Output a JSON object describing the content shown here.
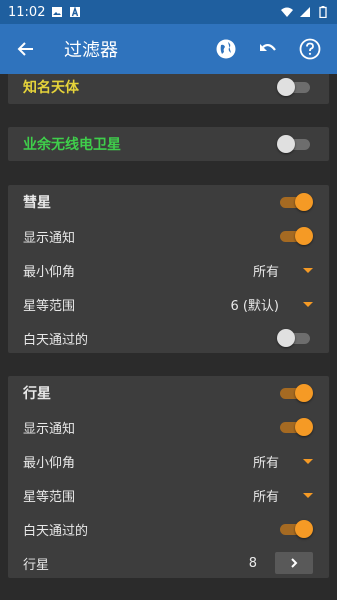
{
  "status_bar": {
    "time": "11:02",
    "left_icons": [
      "image-icon",
      "a-notification-icon"
    ],
    "right_icons": [
      "wifi-icon",
      "signal-icon",
      "battery-icon"
    ]
  },
  "app_bar": {
    "title": "过滤器",
    "back_icon": "back-arrow-icon",
    "actions": [
      "globe-icon",
      "undo-icon",
      "help-icon"
    ]
  },
  "colors": {
    "famous_label": "#e5d33a",
    "ham_label": "#3fce4b",
    "accent": "#f59a25",
    "appbar": "#2f73bd",
    "statusbar": "#1f5f9f"
  },
  "famous": {
    "label": "知名天体",
    "enabled": false
  },
  "ham": {
    "label": "业余无线电卫星",
    "enabled": false
  },
  "comets": {
    "title": "彗星",
    "enabled": true,
    "notify_label": "显示通知",
    "notify": true,
    "min_elev_label": "最小仰角",
    "min_elev_value": "所有",
    "mag_label": "星等范围",
    "mag_value": "6 (默认)",
    "daytime_label": "白天通过的",
    "daytime": false
  },
  "planets": {
    "title": "行星",
    "enabled": true,
    "notify_label": "显示通知",
    "notify": true,
    "min_elev_label": "最小仰角",
    "min_elev_value": "所有",
    "mag_label": "星等范围",
    "mag_value": "所有",
    "daytime_label": "白天通过的",
    "daytime": true,
    "planets_label": "行星",
    "planets_count": "8"
  }
}
